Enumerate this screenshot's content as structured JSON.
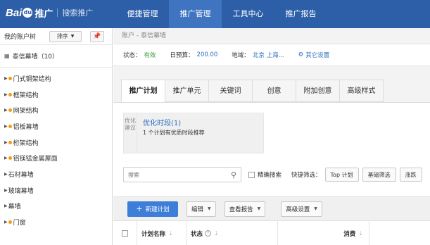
{
  "header": {
    "logo_text": "Bai",
    "logo_paw": "du",
    "brand": "推广",
    "product": "搜索推广",
    "nav": [
      "便捷管理",
      "推广管理",
      "工具中心",
      "推广报告"
    ],
    "active_nav": 1,
    "bg_color": "#2d5fa8"
  },
  "sidebar": {
    "title": "我的账户树",
    "sort_label": "排序",
    "pin_icon": "pin-icon",
    "account": "泰信幕墙（10）",
    "items": [
      {
        "label": "门式钢架结构"
      },
      {
        "label": "框架结构"
      },
      {
        "label": "网架结构"
      },
      {
        "label": "铝板幕墙"
      },
      {
        "label": "桁架结构"
      },
      {
        "label": "铝镁锰金属屋面"
      },
      {
        "label": "石材幕墙"
      },
      {
        "label": "玻璃幕墙"
      },
      {
        "label": "幕墙"
      },
      {
        "label": "门窗"
      }
    ]
  },
  "main": {
    "breadcrumb": "账户 - 泰信幕墙",
    "info": {
      "status_label": "状态：",
      "status_value": "有效",
      "budget_label": "日预算：",
      "budget_value": "200.00",
      "region_label": "地域：",
      "region_value": "北京 上海...",
      "other_settings": "其它设置"
    },
    "tabs": [
      "推广计划",
      "推广单元",
      "关键词",
      "创意",
      "附加创意",
      "高级样式"
    ],
    "active_tab": 0,
    "suggestion": {
      "label": "优化建议",
      "title": "优化时段(1)",
      "desc": "1 个计划有优质时段推荐"
    },
    "filters": {
      "search_placeholder": "搜索",
      "exact_search": "精确搜索",
      "quick_filter_label": "快捷筛选：",
      "quick_buttons": [
        "Top 计划",
        "基础筛选",
        "涨跌"
      ]
    },
    "toolbar": {
      "new_plan": "新建计划",
      "edit": "编辑",
      "view_report": "查看报告",
      "advanced": "高级设置"
    },
    "table": {
      "columns": [
        "计划名称",
        "状态",
        "消费"
      ]
    }
  }
}
